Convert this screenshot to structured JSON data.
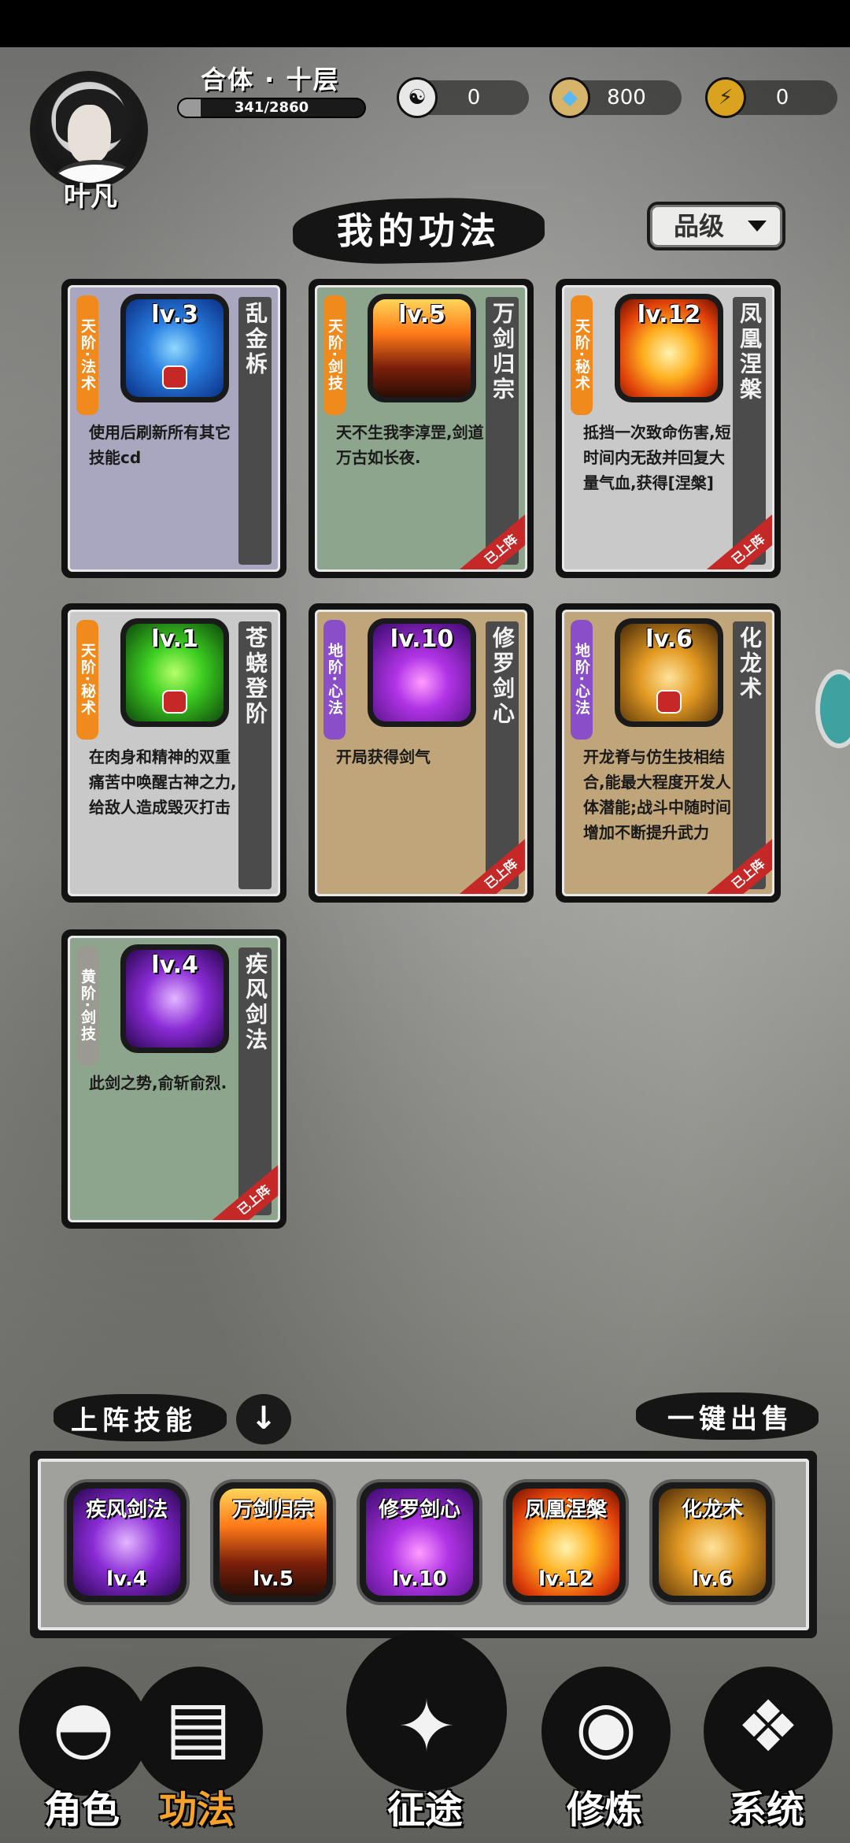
{
  "player": {
    "name": "叶凡",
    "realm": "合体 · 十层",
    "xp_text": "341/2860",
    "xp_fraction": 0.119
  },
  "resources": [
    {
      "icon": "yin-yang-icon",
      "value": "0"
    },
    {
      "icon": "spirit-gem-icon",
      "value": "800"
    },
    {
      "icon": "lightning-icon",
      "value": "0"
    }
  ],
  "page_title": "我的功法",
  "sort_button": {
    "label": "品级"
  },
  "skills": [
    {
      "grade": "天阶·法术",
      "grade_type": "tian",
      "level": "lv.3",
      "name": "乱金柝",
      "desc": "使用后刷新所有其它技能cd",
      "bg": "purple",
      "art": "blue",
      "locked": true,
      "equipped": false
    },
    {
      "grade": "天阶·剑技",
      "grade_type": "tian",
      "level": "lv.5",
      "name": "万剑归宗",
      "desc": "天不生我李淳罡,剑道万古如长夜.",
      "bg": "green",
      "art": "volcano",
      "locked": false,
      "equipped": true
    },
    {
      "grade": "天阶·秘术",
      "grade_type": "tian",
      "level": "lv.12",
      "name": "凤凰涅槃",
      "desc": "抵挡一次致命伤害,短时间内无敌并回复大量气血,获得[涅槃]",
      "bg": "gray",
      "art": "phoenix",
      "locked": false,
      "equipped": true
    },
    {
      "grade": "天阶·秘术",
      "grade_type": "tian",
      "level": "lv.1",
      "name": "苍蛲登阶",
      "desc": "在肉身和精神的双重痛苦中唤醒古神之力,给敌人造成毁灭打击",
      "bg": "gray",
      "art": "green",
      "locked": true,
      "equipped": false
    },
    {
      "grade": "地阶·心法",
      "grade_type": "di",
      "level": "lv.10",
      "name": "修罗剑心",
      "desc": "开局获得剑气",
      "bg": "tan",
      "art": "violet",
      "locked": false,
      "equipped": true
    },
    {
      "grade": "地阶·心法",
      "grade_type": "di",
      "level": "lv.6",
      "name": "化龙术",
      "desc": "开龙脊与仿生技相结合,能最大程度开发人体潜能;战斗中随时间增加不断提升武力",
      "bg": "tan",
      "art": "gold",
      "locked": true,
      "equipped": true
    },
    {
      "grade": "黄阶·剑技",
      "grade_type": "huang",
      "level": "lv.4",
      "name": "疾风剑法",
      "desc": "此剑之势,俞斩俞烈.",
      "bg": "green",
      "art": "purple-blade",
      "locked": false,
      "equipped": true
    }
  ],
  "equipped_tag": "已上阵",
  "active_section": {
    "label": "上阵技能",
    "down_icon": "arrow-down-icon"
  },
  "sell_all": {
    "label": "一键出售"
  },
  "active_slots": [
    {
      "name": "疾风剑法",
      "level": "lv.4",
      "art": "purple-blade"
    },
    {
      "name": "万剑归宗",
      "level": "lv.5",
      "art": "volcano"
    },
    {
      "name": "修罗剑心",
      "level": "lv.10",
      "art": "violet"
    },
    {
      "name": "凤凰涅槃",
      "level": "lv.12",
      "art": "phoenix"
    },
    {
      "name": "化龙术",
      "level": "lv.6",
      "art": "gold"
    }
  ],
  "nav": [
    {
      "label": "角色",
      "icon": "hooded-figure-icon",
      "active": false
    },
    {
      "label": "功法",
      "icon": "scroll-book-icon",
      "active": true
    },
    {
      "label": "征途",
      "icon": "sword-emblem-icon",
      "active": false
    },
    {
      "label": "修炼",
      "icon": "meditation-icon",
      "active": false
    },
    {
      "label": "系统",
      "icon": "panda-icon",
      "active": false
    }
  ]
}
